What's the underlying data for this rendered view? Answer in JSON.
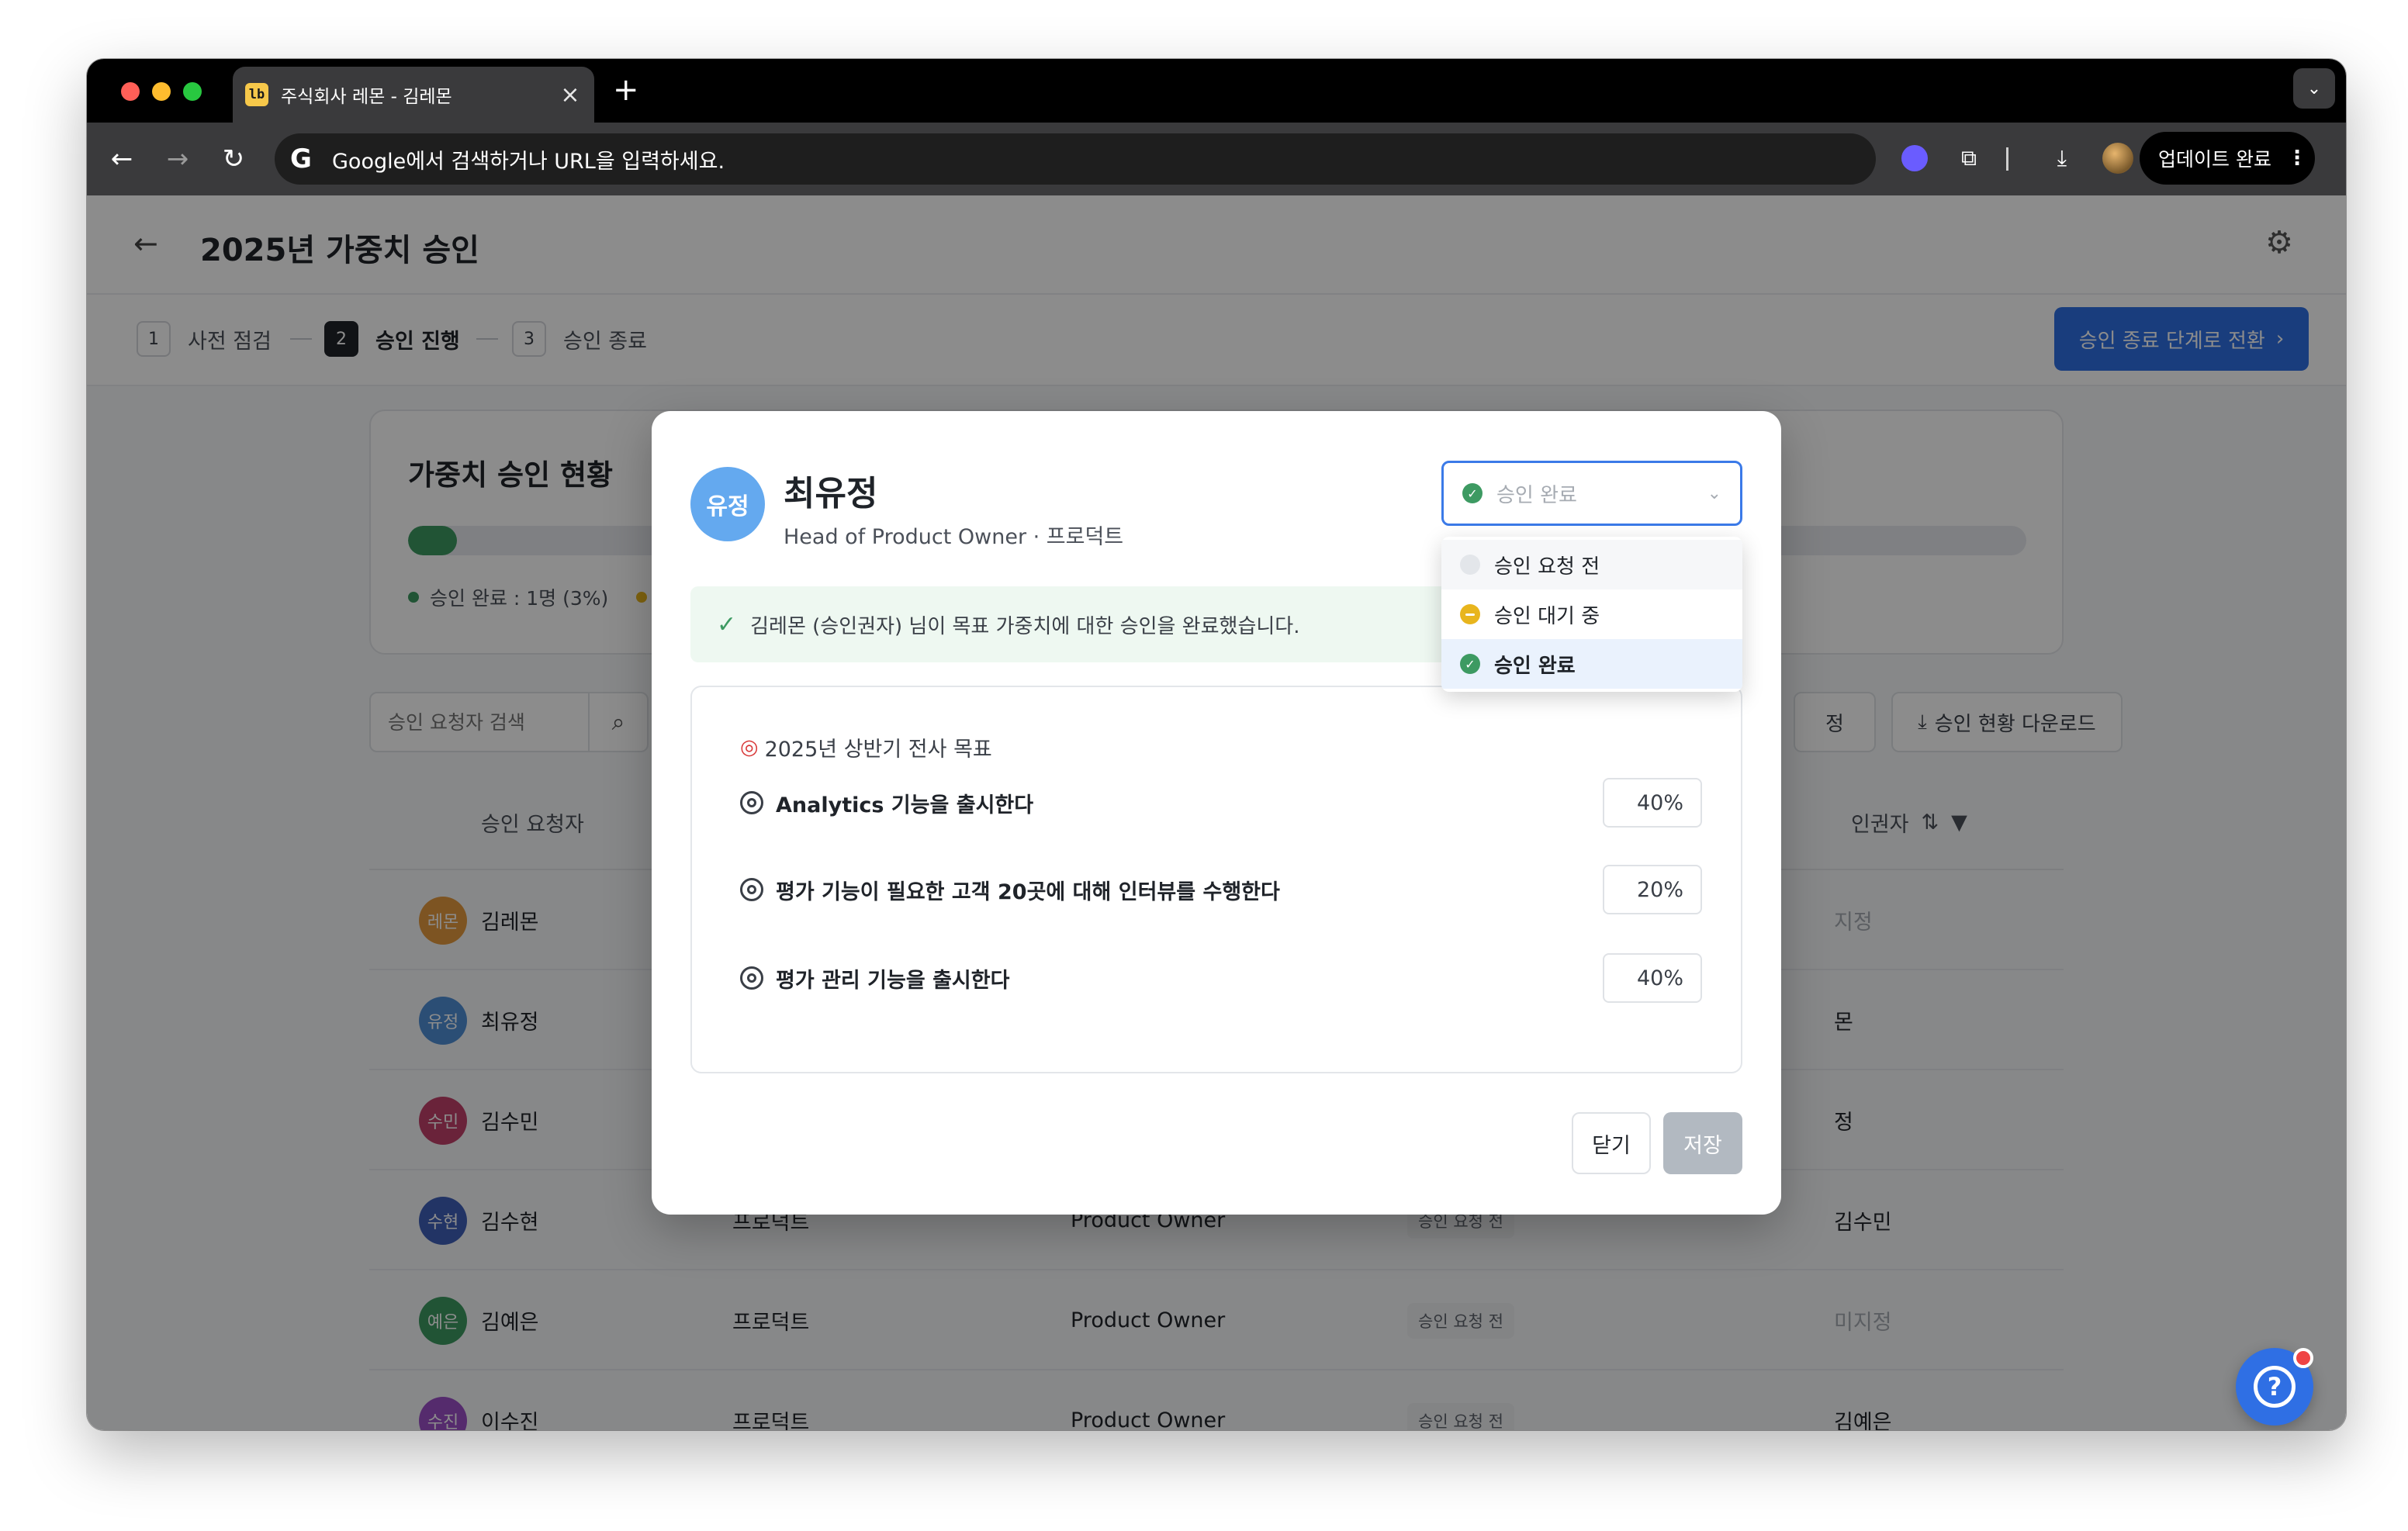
{
  "browser": {
    "tab_title": "주식회사 레몬 - 김레몬",
    "tab_favicon": "lb",
    "address_placeholder": "Google에서 검색하거나 URL을 입력하세요.",
    "update_label": "업데이트 완료"
  },
  "page": {
    "title": "2025년 가중치 승인",
    "steps": [
      {
        "num": "1",
        "label": "사전 점검"
      },
      {
        "num": "2",
        "label": "승인 진행"
      },
      {
        "num": "3",
        "label": "승인 종료"
      }
    ],
    "active_step": 2,
    "primary_action": "승인 종료 단계로 전환"
  },
  "status_card": {
    "title": "가중치 승인 현황",
    "progress_fraction": 0.03,
    "legend_done": "승인 완료 : 1명 (3%)"
  },
  "filters": {
    "search_placeholder": "승인 요청자 검색",
    "partial_button": "정",
    "download_label": "승인 현황 다운로드"
  },
  "table": {
    "headers": {
      "requester": "승인 요청자",
      "approver_partial": "인권자"
    },
    "rows": [
      {
        "avatar": "레몬",
        "avatar_color": "#e49a3e",
        "name": "김레몬",
        "dept": "",
        "role": "",
        "status": "",
        "approver": "지정",
        "approver_muted": true
      },
      {
        "avatar": "유정",
        "avatar_color": "#4f8fd6",
        "name": "최유정",
        "dept": "",
        "role": "",
        "status": "",
        "approver": "몬",
        "approver_muted": false
      },
      {
        "avatar": "수민",
        "avatar_color": "#c2416a",
        "name": "김수민",
        "dept": "",
        "role": "",
        "status": "",
        "approver": "정",
        "approver_muted": false
      },
      {
        "avatar": "수현",
        "avatar_color": "#3f5fb8",
        "name": "김수현",
        "dept": "프로덕트",
        "role": "Product Owner",
        "status": "승인 요청 전",
        "approver": "김수민",
        "approver_muted": false
      },
      {
        "avatar": "예은",
        "avatar_color": "#3d9a62",
        "name": "김예은",
        "dept": "프로덕트",
        "role": "Product Owner",
        "status": "승인 요청 전",
        "approver": "미지정",
        "approver_muted": true
      },
      {
        "avatar": "수진",
        "avatar_color": "#9b4fc7",
        "name": "이수진",
        "dept": "프로덕트",
        "role": "Product Owner",
        "status": "승인 요청 전",
        "approver": "김예은",
        "approver_muted": false
      }
    ]
  },
  "modal": {
    "avatar": "유정",
    "name": "최유정",
    "role": "Head of Product Owner · 프로덕트",
    "status_value": "승인 완료",
    "notice": "김레몬 (승인권자) 님이 목표 가중치에 대한 승인을 완료했습니다.",
    "goal_group_title": "2025년 상반기 전사 목표",
    "goals": [
      {
        "text": "Analytics 기능을 출시한다",
        "weight": "40%"
      },
      {
        "text": "평가 기능이 필요한 고객 20곳에 대해 인터뷰를 수행한다",
        "weight": "20%"
      },
      {
        "text": "평가 관리 기능을 출시한다",
        "weight": "40%"
      }
    ],
    "close_label": "닫기",
    "save_label": "저장",
    "dropdown_options": [
      {
        "label": "승인 요청 전",
        "color": "grey"
      },
      {
        "label": "승인 대기 중",
        "color": "yellow"
      },
      {
        "label": "승인 완료",
        "color": "green"
      }
    ],
    "selected_option": "승인 완료"
  },
  "colors": {
    "accent": "#2f6fe4",
    "success": "#3d9a62",
    "pending": "#e8b51d"
  }
}
